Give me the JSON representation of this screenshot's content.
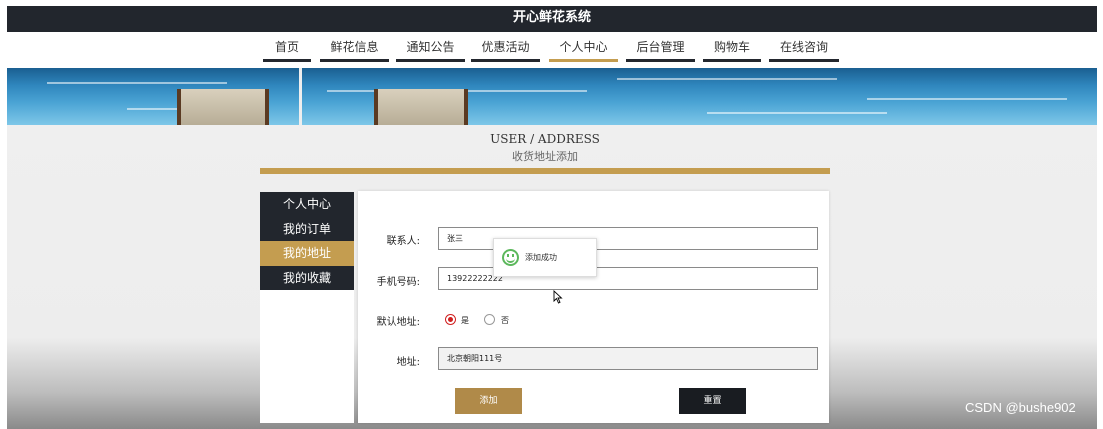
{
  "header": {
    "title": "开心鲜花系统"
  },
  "nav": {
    "items": [
      {
        "label": "首页"
      },
      {
        "label": "鲜花信息"
      },
      {
        "label": "通知公告"
      },
      {
        "label": "优惠活动"
      },
      {
        "label": "个人中心",
        "active": true
      },
      {
        "label": "后台管理"
      },
      {
        "label": "购物车"
      },
      {
        "label": "在线咨询"
      }
    ]
  },
  "section": {
    "title_en": "USER / ADDRESS",
    "title_cn": "收货地址添加"
  },
  "sidebar": {
    "items": [
      {
        "label": "个人中心"
      },
      {
        "label": "我的订单"
      },
      {
        "label": "我的地址",
        "active": true
      },
      {
        "label": "我的收藏"
      }
    ]
  },
  "form": {
    "contact_label": "联系人:",
    "contact_value": "张三",
    "phone_label": "手机号码:",
    "phone_value": "13922222222",
    "default_label": "默认地址:",
    "default_yes": "是",
    "default_no": "否",
    "default_selected": "是",
    "address_label": "地址:",
    "address_value": "北京朝阳111号",
    "add_button": "添加",
    "reset_button": "重置"
  },
  "toast": {
    "message": "添加成功",
    "icon": "smile-icon"
  },
  "watermark": "CSDN @bushe902",
  "colors": {
    "dark": "#22262d",
    "accent": "#c49d50",
    "radio": "#d02020",
    "toast_icon": "#5cb85c"
  }
}
